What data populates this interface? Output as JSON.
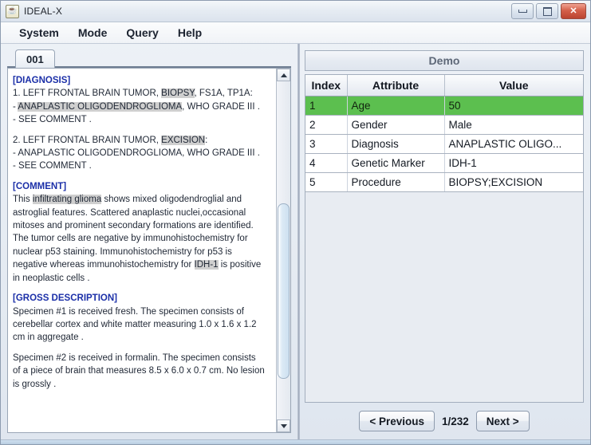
{
  "window": {
    "title": "IDEAL-X",
    "icon": "java-coffee-cup-icon",
    "minimize_label": "–",
    "maximize_label": "□",
    "close_label": "✕"
  },
  "menubar": {
    "items": [
      {
        "label": "System"
      },
      {
        "label": "Mode"
      },
      {
        "label": "Query"
      },
      {
        "label": "Help"
      }
    ]
  },
  "left_panel": {
    "tabs": [
      {
        "label": "001"
      }
    ],
    "report": {
      "sections": [
        {
          "heading": "[DIAGNOSIS]",
          "lines": [
            [
              {
                "t": "1.  LEFT FRONTAL BRAIN TUMOR, ",
                "h": false
              },
              {
                "t": "BIOPSY",
                "h": true
              },
              {
                "t": ", FS1A, TP1A:",
                "h": false
              }
            ],
            [
              {
                "t": "- ",
                "h": false
              },
              {
                "t": "ANAPLASTIC OLIGODENDROGLIOMA",
                "h": true
              },
              {
                "t": ", WHO GRADE III .",
                "h": false
              }
            ],
            [
              {
                "t": "- SEE COMMENT .",
                "h": false
              }
            ],
            [],
            [
              {
                "t": "2.  LEFT FRONTAL BRAIN TUMOR, ",
                "h": false
              },
              {
                "t": "EXCISION",
                "h": true
              },
              {
                "t": ":",
                "h": false
              }
            ],
            [
              {
                "t": "- ANAPLASTIC OLIGODENDROGLIOMA, WHO GRADE III .",
                "h": false
              }
            ],
            [
              {
                "t": "- SEE COMMENT .",
                "h": false
              }
            ]
          ]
        },
        {
          "heading": "[COMMENT]",
          "lines": [
            [
              {
                "t": "This ",
                "h": false
              },
              {
                "t": "infiltrating glioma",
                "h": true
              },
              {
                "t": " shows mixed oligodendroglial and",
                "h": false
              }
            ],
            [
              {
                "t": "astroglial features. Scattered anaplastic nuclei,occasional",
                "h": false
              }
            ],
            [
              {
                "t": "mitoses and prominent secondary formations are identified.",
                "h": false
              }
            ],
            [
              {
                "t": "The tumor cells are negative by immunohistochemistry for",
                "h": false
              }
            ],
            [
              {
                "t": "nuclear p53 staining. Immunohistochemistry for p53 is",
                "h": false
              }
            ],
            [
              {
                "t": "negative whereas immunohistochemistry for ",
                "h": false
              },
              {
                "t": "IDH-1",
                "h": true
              },
              {
                "t": " is positive",
                "h": false
              }
            ],
            [
              {
                "t": "in neoplastic cells .",
                "h": false
              }
            ]
          ]
        },
        {
          "heading": "[GROSS DESCRIPTION]",
          "lines": [
            [
              {
                "t": "Specimen #1 is received fresh. The specimen consists of",
                "h": false
              }
            ],
            [
              {
                "t": "cerebellar cortex and white matter measuring 1.0 x 1.6 x 1.2",
                "h": false
              }
            ],
            [
              {
                "t": "cm in aggregate .",
                "h": false
              }
            ],
            [],
            [
              {
                "t": "Specimen #2 is received in formalin. The specimen consists",
                "h": false
              }
            ],
            [
              {
                "t": "of a piece of brain that measures 8.5 x 6.0 x 0.7 cm.  No lesion",
                "h": false
              }
            ],
            [
              {
                "t": "is grossly .",
                "h": false
              }
            ]
          ]
        }
      ]
    },
    "scrollbar": {
      "up_arrow": "scroll-up-icon",
      "down_arrow": "scroll-down-icon"
    }
  },
  "right_panel": {
    "header": "Demo",
    "table": {
      "columns": [
        "Index",
        "Attribute",
        "Value"
      ],
      "rows": [
        {
          "index": "1",
          "attribute": "Age",
          "value": "50",
          "selected": true
        },
        {
          "index": "2",
          "attribute": "Gender",
          "value": "Male",
          "selected": false
        },
        {
          "index": "3",
          "attribute": "Diagnosis",
          "value": "ANAPLASTIC OLIGO...",
          "selected": false
        },
        {
          "index": "4",
          "attribute": "Genetic Marker",
          "value": "IDH-1",
          "selected": false
        },
        {
          "index": "5",
          "attribute": "Procedure",
          "value": "BIOPSY;EXCISION",
          "selected": false
        }
      ]
    },
    "navigation": {
      "previous_label": "< Previous",
      "counter": "1/232",
      "next_label": "Next >"
    }
  },
  "colors": {
    "selected_row": "#5cbf4f",
    "section_heading": "#1b2fa8",
    "highlight": "#cfcfcf",
    "close_button": "#bb4430"
  }
}
